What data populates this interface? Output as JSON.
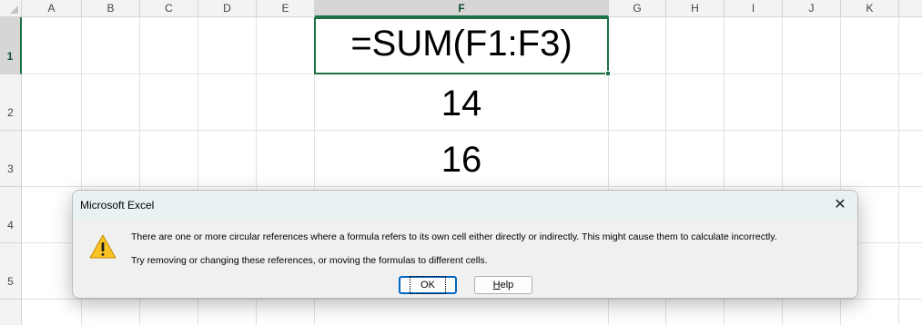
{
  "columns": [
    "A",
    "B",
    "C",
    "D",
    "E",
    "F",
    "G",
    "H",
    "I",
    "J",
    "K"
  ],
  "rows": [
    "1",
    "2",
    "3",
    "4",
    "5"
  ],
  "cells": {
    "F1": "=SUM(F1:F3)",
    "F2": "14",
    "F3": "16"
  },
  "dialog": {
    "title": "Microsoft Excel",
    "close_glyph": "✕",
    "message_line1": "There are one or more circular references where a formula refers to its own cell either directly or indirectly. This might cause them to calculate incorrectly.",
    "message_line2": "Try removing or changing these references, or moving the formulas to different cells.",
    "ok_label": "OK",
    "help_label_underlined": "H",
    "help_label_rest": "elp"
  },
  "colors": {
    "selection_green": "#1e7145",
    "warning_yellow": "#f7c325"
  },
  "icons": {
    "dialog_icon": "warning-icon"
  }
}
